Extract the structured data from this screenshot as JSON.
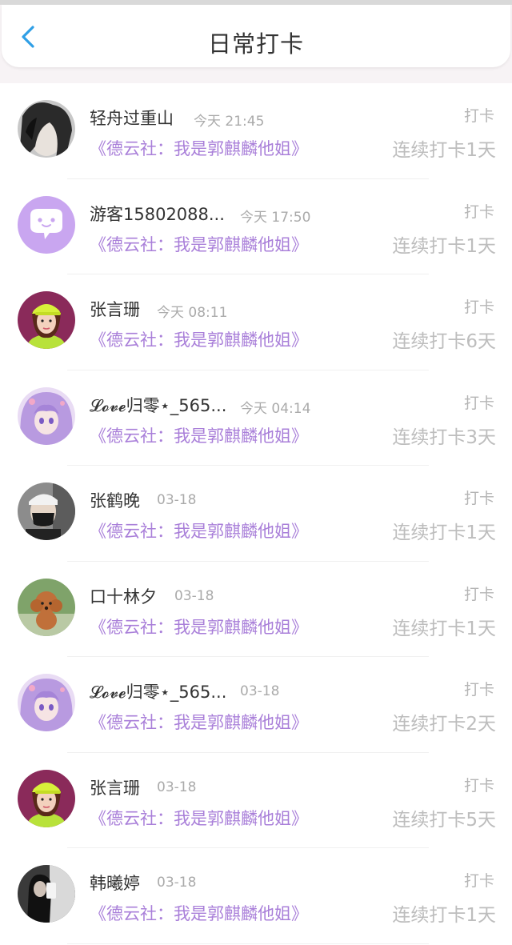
{
  "header": {
    "title": "日常打卡",
    "back_icon": "chevron-left-icon",
    "accent_color": "#2f9fe6"
  },
  "list": {
    "items": [
      {
        "name": "轻舟过重山",
        "time": "今天 21:45",
        "book": "《德云社：我是郭麒麟他姐》",
        "tag": "打卡",
        "streak": "连续打卡1天",
        "avatar": "dark-hair-avatar"
      },
      {
        "name": "游客15802088...",
        "time": "今天 17:50",
        "book": "《德云社：我是郭麒麟他姐》",
        "tag": "打卡",
        "streak": "连续打卡1天",
        "avatar": "purple-chat-bubble-avatar"
      },
      {
        "name": "张言珊",
        "time": "今天 08:11",
        "book": "《德云社：我是郭麒麟他姐》",
        "tag": "打卡",
        "streak": "连续打卡6天",
        "avatar": "girl-yellow-cap-avatar"
      },
      {
        "name": "𝓛𝓸𝓿𝓮归零⋆_565...",
        "time": "今天 04:14",
        "book": "《德云社：我是郭麒麟他姐》",
        "tag": "打卡",
        "streak": "连续打卡3天",
        "avatar": "anime-girl-avatar"
      },
      {
        "name": "张鹤晚",
        "time": "03-18",
        "book": "《德云社：我是郭麒麟他姐》",
        "tag": "打卡",
        "streak": "连续打卡1天",
        "avatar": "masked-man-avatar"
      },
      {
        "name": "口十林夕",
        "time": "03-18",
        "book": "《德云社：我是郭麒麟他姐》",
        "tag": "打卡",
        "streak": "连续打卡1天",
        "avatar": "poodle-dog-avatar"
      },
      {
        "name": "𝓛𝓸𝓿𝓮归零⋆_565...",
        "time": "03-18",
        "book": "《德云社：我是郭麒麟他姐》",
        "tag": "打卡",
        "streak": "连续打卡2天",
        "avatar": "anime-girl-avatar"
      },
      {
        "name": "张言珊",
        "time": "03-18",
        "book": "《德云社：我是郭麒麟他姐》",
        "tag": "打卡",
        "streak": "连续打卡5天",
        "avatar": "girl-yellow-cap-avatar"
      },
      {
        "name": "韩曦婷",
        "time": "03-18",
        "book": "《德云社：我是郭麒麟他姐》",
        "tag": "打卡",
        "streak": "连续打卡1天",
        "avatar": "mirror-selfie-avatar"
      }
    ]
  },
  "colors": {
    "book_title": "#a97fd9",
    "name": "#333333",
    "meta": "#aaaaaa"
  }
}
